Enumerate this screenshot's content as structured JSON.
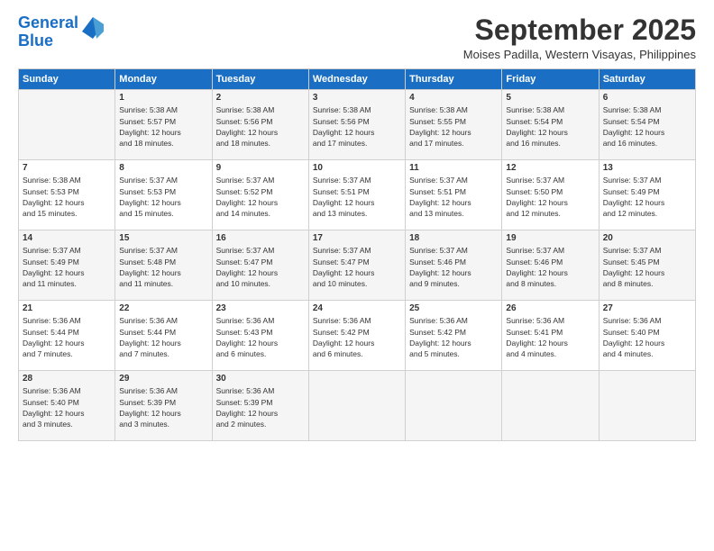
{
  "logo": {
    "line1": "General",
    "line2": "Blue"
  },
  "title": "September 2025",
  "location": "Moises Padilla, Western Visayas, Philippines",
  "weekdays": [
    "Sunday",
    "Monday",
    "Tuesday",
    "Wednesday",
    "Thursday",
    "Friday",
    "Saturday"
  ],
  "weeks": [
    [
      {
        "day": "",
        "content": ""
      },
      {
        "day": "1",
        "content": "Sunrise: 5:38 AM\nSunset: 5:57 PM\nDaylight: 12 hours\nand 18 minutes."
      },
      {
        "day": "2",
        "content": "Sunrise: 5:38 AM\nSunset: 5:56 PM\nDaylight: 12 hours\nand 18 minutes."
      },
      {
        "day": "3",
        "content": "Sunrise: 5:38 AM\nSunset: 5:56 PM\nDaylight: 12 hours\nand 17 minutes."
      },
      {
        "day": "4",
        "content": "Sunrise: 5:38 AM\nSunset: 5:55 PM\nDaylight: 12 hours\nand 17 minutes."
      },
      {
        "day": "5",
        "content": "Sunrise: 5:38 AM\nSunset: 5:54 PM\nDaylight: 12 hours\nand 16 minutes."
      },
      {
        "day": "6",
        "content": "Sunrise: 5:38 AM\nSunset: 5:54 PM\nDaylight: 12 hours\nand 16 minutes."
      }
    ],
    [
      {
        "day": "7",
        "content": "Sunrise: 5:38 AM\nSunset: 5:53 PM\nDaylight: 12 hours\nand 15 minutes."
      },
      {
        "day": "8",
        "content": "Sunrise: 5:37 AM\nSunset: 5:53 PM\nDaylight: 12 hours\nand 15 minutes."
      },
      {
        "day": "9",
        "content": "Sunrise: 5:37 AM\nSunset: 5:52 PM\nDaylight: 12 hours\nand 14 minutes."
      },
      {
        "day": "10",
        "content": "Sunrise: 5:37 AM\nSunset: 5:51 PM\nDaylight: 12 hours\nand 13 minutes."
      },
      {
        "day": "11",
        "content": "Sunrise: 5:37 AM\nSunset: 5:51 PM\nDaylight: 12 hours\nand 13 minutes."
      },
      {
        "day": "12",
        "content": "Sunrise: 5:37 AM\nSunset: 5:50 PM\nDaylight: 12 hours\nand 12 minutes."
      },
      {
        "day": "13",
        "content": "Sunrise: 5:37 AM\nSunset: 5:49 PM\nDaylight: 12 hours\nand 12 minutes."
      }
    ],
    [
      {
        "day": "14",
        "content": "Sunrise: 5:37 AM\nSunset: 5:49 PM\nDaylight: 12 hours\nand 11 minutes."
      },
      {
        "day": "15",
        "content": "Sunrise: 5:37 AM\nSunset: 5:48 PM\nDaylight: 12 hours\nand 11 minutes."
      },
      {
        "day": "16",
        "content": "Sunrise: 5:37 AM\nSunset: 5:47 PM\nDaylight: 12 hours\nand 10 minutes."
      },
      {
        "day": "17",
        "content": "Sunrise: 5:37 AM\nSunset: 5:47 PM\nDaylight: 12 hours\nand 10 minutes."
      },
      {
        "day": "18",
        "content": "Sunrise: 5:37 AM\nSunset: 5:46 PM\nDaylight: 12 hours\nand 9 minutes."
      },
      {
        "day": "19",
        "content": "Sunrise: 5:37 AM\nSunset: 5:46 PM\nDaylight: 12 hours\nand 8 minutes."
      },
      {
        "day": "20",
        "content": "Sunrise: 5:37 AM\nSunset: 5:45 PM\nDaylight: 12 hours\nand 8 minutes."
      }
    ],
    [
      {
        "day": "21",
        "content": "Sunrise: 5:36 AM\nSunset: 5:44 PM\nDaylight: 12 hours\nand 7 minutes."
      },
      {
        "day": "22",
        "content": "Sunrise: 5:36 AM\nSunset: 5:44 PM\nDaylight: 12 hours\nand 7 minutes."
      },
      {
        "day": "23",
        "content": "Sunrise: 5:36 AM\nSunset: 5:43 PM\nDaylight: 12 hours\nand 6 minutes."
      },
      {
        "day": "24",
        "content": "Sunrise: 5:36 AM\nSunset: 5:42 PM\nDaylight: 12 hours\nand 6 minutes."
      },
      {
        "day": "25",
        "content": "Sunrise: 5:36 AM\nSunset: 5:42 PM\nDaylight: 12 hours\nand 5 minutes."
      },
      {
        "day": "26",
        "content": "Sunrise: 5:36 AM\nSunset: 5:41 PM\nDaylight: 12 hours\nand 4 minutes."
      },
      {
        "day": "27",
        "content": "Sunrise: 5:36 AM\nSunset: 5:40 PM\nDaylight: 12 hours\nand 4 minutes."
      }
    ],
    [
      {
        "day": "28",
        "content": "Sunrise: 5:36 AM\nSunset: 5:40 PM\nDaylight: 12 hours\nand 3 minutes."
      },
      {
        "day": "29",
        "content": "Sunrise: 5:36 AM\nSunset: 5:39 PM\nDaylight: 12 hours\nand 3 minutes."
      },
      {
        "day": "30",
        "content": "Sunrise: 5:36 AM\nSunset: 5:39 PM\nDaylight: 12 hours\nand 2 minutes."
      },
      {
        "day": "",
        "content": ""
      },
      {
        "day": "",
        "content": ""
      },
      {
        "day": "",
        "content": ""
      },
      {
        "day": "",
        "content": ""
      }
    ]
  ]
}
